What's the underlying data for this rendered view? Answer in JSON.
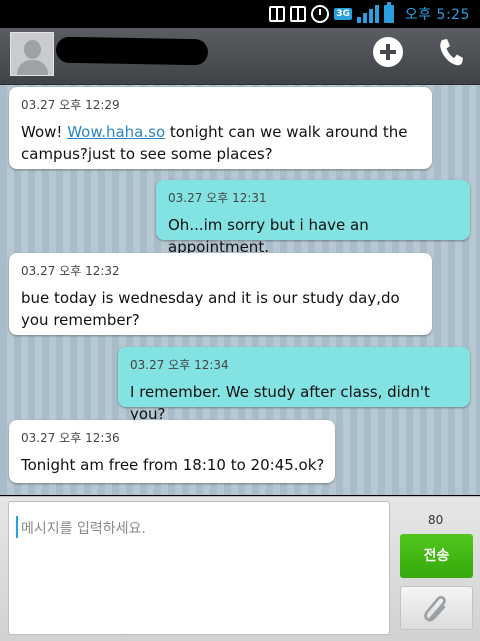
{
  "status_bar": {
    "time": "오후 5:25",
    "network": "3G"
  },
  "contact": {
    "name_redacted": true
  },
  "messages": [
    {
      "direction": "incoming",
      "timestamp": "03.27 오후 12:29",
      "text_prefix": "Wow! ",
      "link": "Wow.haha.so",
      "text_suffix": " tonight can we walk around the campus?just to see some places?"
    },
    {
      "direction": "outgoing",
      "timestamp": "03.27 오후 12:31",
      "text": "Oh...im sorry but i have an appointment."
    },
    {
      "direction": "incoming",
      "timestamp": "03.27 오후 12:32",
      "text": "bue today is wednesday and it is our study day,do you remember?"
    },
    {
      "direction": "outgoing",
      "timestamp": "03.27 오후 12:34",
      "text": "I remember. We study after class, didn't you?"
    },
    {
      "direction": "incoming",
      "timestamp": "03.27 오후 12:36",
      "text": "Tonight am free from 18:10 to 20:45.ok?"
    }
  ],
  "composer": {
    "placeholder": "메시지를 입력하세요.",
    "char_count": "80",
    "send_label": "전송"
  },
  "icons": {
    "add": "plus-circle-icon",
    "call": "phone-icon",
    "attach": "paperclip-icon"
  },
  "colors": {
    "incoming_bubble": "#ffffff",
    "outgoing_bubble": "#83e3e3",
    "send_button": "#44b815",
    "link": "#2a86c8"
  }
}
